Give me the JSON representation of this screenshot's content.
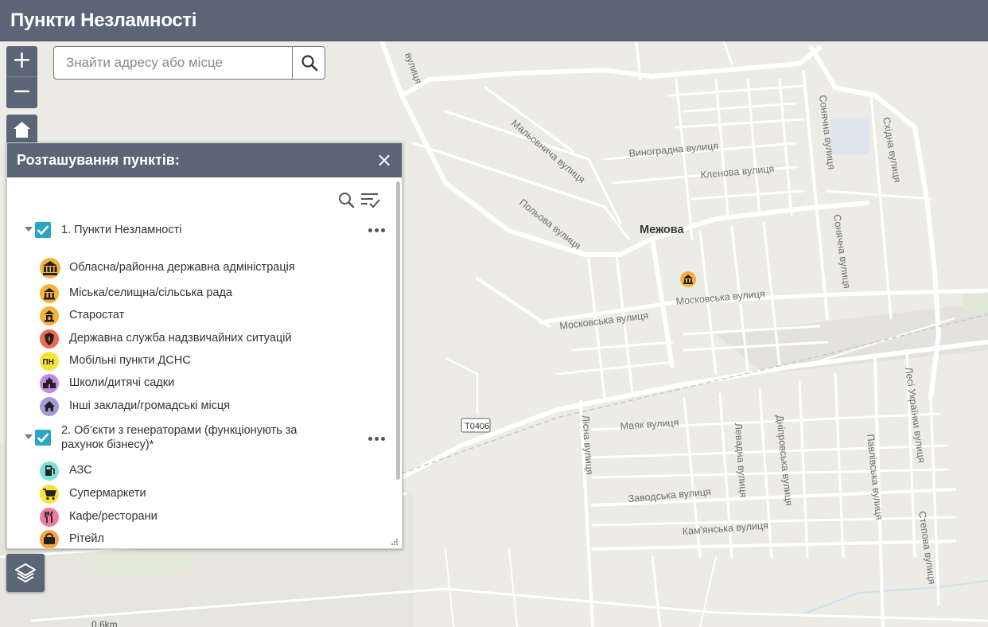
{
  "header": {
    "title": "Пункти Незламності"
  },
  "search": {
    "placeholder": "Знайти адресу або місце"
  },
  "zoom": {
    "in_label": "+",
    "out_label": "−"
  },
  "legend": {
    "title": "Розташування пунктів:",
    "close_label": "×",
    "groups": [
      {
        "label": "1. Пункти Незламності",
        "checked": true,
        "items": [
          {
            "label": "Обласна/районна державна адміністрація",
            "icon": "oblast-administration-icon",
            "color": "#f6b33b"
          },
          {
            "label": "Міська/селищна/сільська рада",
            "icon": "city-council-icon",
            "color": "#f6b33b"
          },
          {
            "label": "Старостат",
            "icon": "starostat-icon",
            "color": "#f6b33b"
          },
          {
            "label": "Державна служба надзвичайних ситуацій",
            "icon": "emergency-service-icon",
            "color": "#ef6a4f"
          },
          {
            "label": "Мобільні пункти ДСНС",
            "icon": "mobile-point-icon",
            "color": "#f8e33a",
            "badge": "ПН"
          },
          {
            "label": "Школи/дитячі садки",
            "icon": "school-icon",
            "color": "#c48ae0"
          },
          {
            "label": "Інші заклади/громадські місця",
            "icon": "public-place-icon",
            "color": "#a79ad9"
          }
        ]
      },
      {
        "label": "2. Об’єкти з генераторами (функціонують за рахунок бізнесу)*",
        "checked": true,
        "items": [
          {
            "label": "АЗС",
            "icon": "gas-station-icon",
            "color": "#7ee0d6"
          },
          {
            "label": "Супермаркети",
            "icon": "supermarket-icon",
            "color": "#f8e33a"
          },
          {
            "label": "Кафе/ресторани",
            "icon": "restaurant-icon",
            "color": "#f07aa4"
          },
          {
            "label": "Рітейл",
            "icon": "retail-icon",
            "color": "#f6a542"
          }
        ]
      }
    ]
  },
  "map": {
    "town": "Межова",
    "road_badge": "T0406",
    "scale_label": "0.6km",
    "streets": {
      "malovnycha": "Мальовнича вулиця",
      "vynohradna": "Виноградна вулиця",
      "klenova": "Кленова вулиця",
      "sonyachna_top": "Сонячна вулиця",
      "skhidna": "Східна вулиця",
      "polova": "Польова вулиця",
      "sonyachna_mid": "Сонячна вулиця",
      "moskovska_left": "Московська вулиця",
      "moskovska_right": "Московська вулиця",
      "lisna": "Лісна вулиця",
      "mayak": "Маяк вулиця",
      "levadna": "Левадна вулиця",
      "dniprovska": "Дніпровська вулиця",
      "lesi_ukrainky": "Лесі Українки вулиця",
      "pavlivska": "Павлівська вулиця",
      "zavodska": "Заводська вулиця",
      "kamianska": "Кам'янська вулиця",
      "stepova": "Степова вулиця",
      "top_cut": "вулиця"
    },
    "markers": [
      {
        "type": "city-council",
        "color": "#f6b33b"
      }
    ]
  }
}
